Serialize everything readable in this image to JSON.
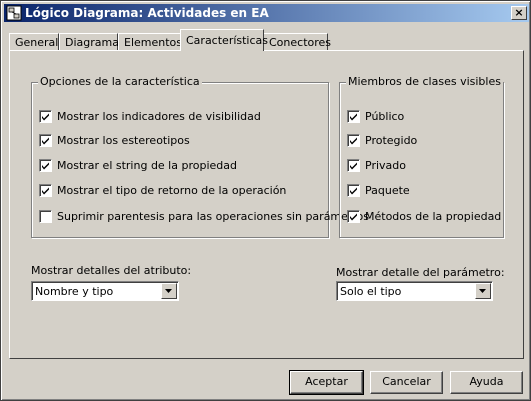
{
  "window": {
    "title": "Lógico Diagrama: Actividades en EA",
    "icon": "diagram-icon",
    "close_glyph": "×"
  },
  "tabs": [
    {
      "label": "General",
      "active": false
    },
    {
      "label": "Diagrama",
      "active": false
    },
    {
      "label": "Elementos",
      "active": false
    },
    {
      "label": "Características",
      "active": true
    },
    {
      "label": "Conectores",
      "active": false
    }
  ],
  "feature_options": {
    "title": "Opciones de la característica",
    "items": [
      {
        "label": "Mostrar los indicadores de visibilidad",
        "checked": true
      },
      {
        "label": "Mostrar los estereotipos",
        "checked": true
      },
      {
        "label": "Mostrar el string de la propiedad",
        "checked": true
      },
      {
        "label": "Mostrar el tipo de retorno de la operación",
        "checked": true
      },
      {
        "label": "Suprimir parentesis para las operaciones sin parámetros",
        "checked": false
      }
    ]
  },
  "visible_members": {
    "title": "Miembros de clases visibles",
    "items": [
      {
        "label": "Público",
        "checked": true
      },
      {
        "label": "Protegido",
        "checked": true
      },
      {
        "label": "Privado",
        "checked": true
      },
      {
        "label": "Paquete",
        "checked": true
      },
      {
        "label": "Métodos de la propiedad",
        "checked": true
      }
    ]
  },
  "attribute_details": {
    "label": "Mostrar detalles del atributo:",
    "selected": "Nombre y tipo"
  },
  "parameter_details": {
    "label": "Mostrar detalle del parámetro:",
    "selected": "Solo el tipo"
  },
  "buttons": {
    "ok": "Aceptar",
    "cancel": "Cancelar",
    "help": "Ayuda"
  }
}
